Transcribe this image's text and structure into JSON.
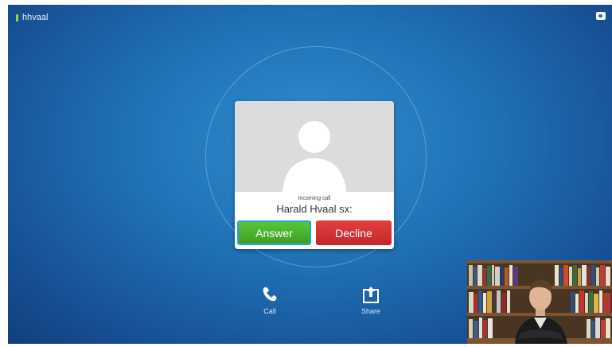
{
  "status": {
    "username": "hhvaal"
  },
  "incoming_call": {
    "label": "Incoming call",
    "caller_name": "Harald Hvaal sx:",
    "answer_label": "Answer",
    "decline_label": "Decline"
  },
  "actions": [
    {
      "label": "Call",
      "icon": "phone-icon"
    },
    {
      "label": "Share",
      "icon": "share-icon"
    }
  ],
  "colors": {
    "answer": "#4cb52e",
    "decline": "#d33236",
    "status_indicator": "#9bd34a",
    "background": "#1f6fb3"
  },
  "selfview": {
    "description_icon": "video-selfview"
  }
}
